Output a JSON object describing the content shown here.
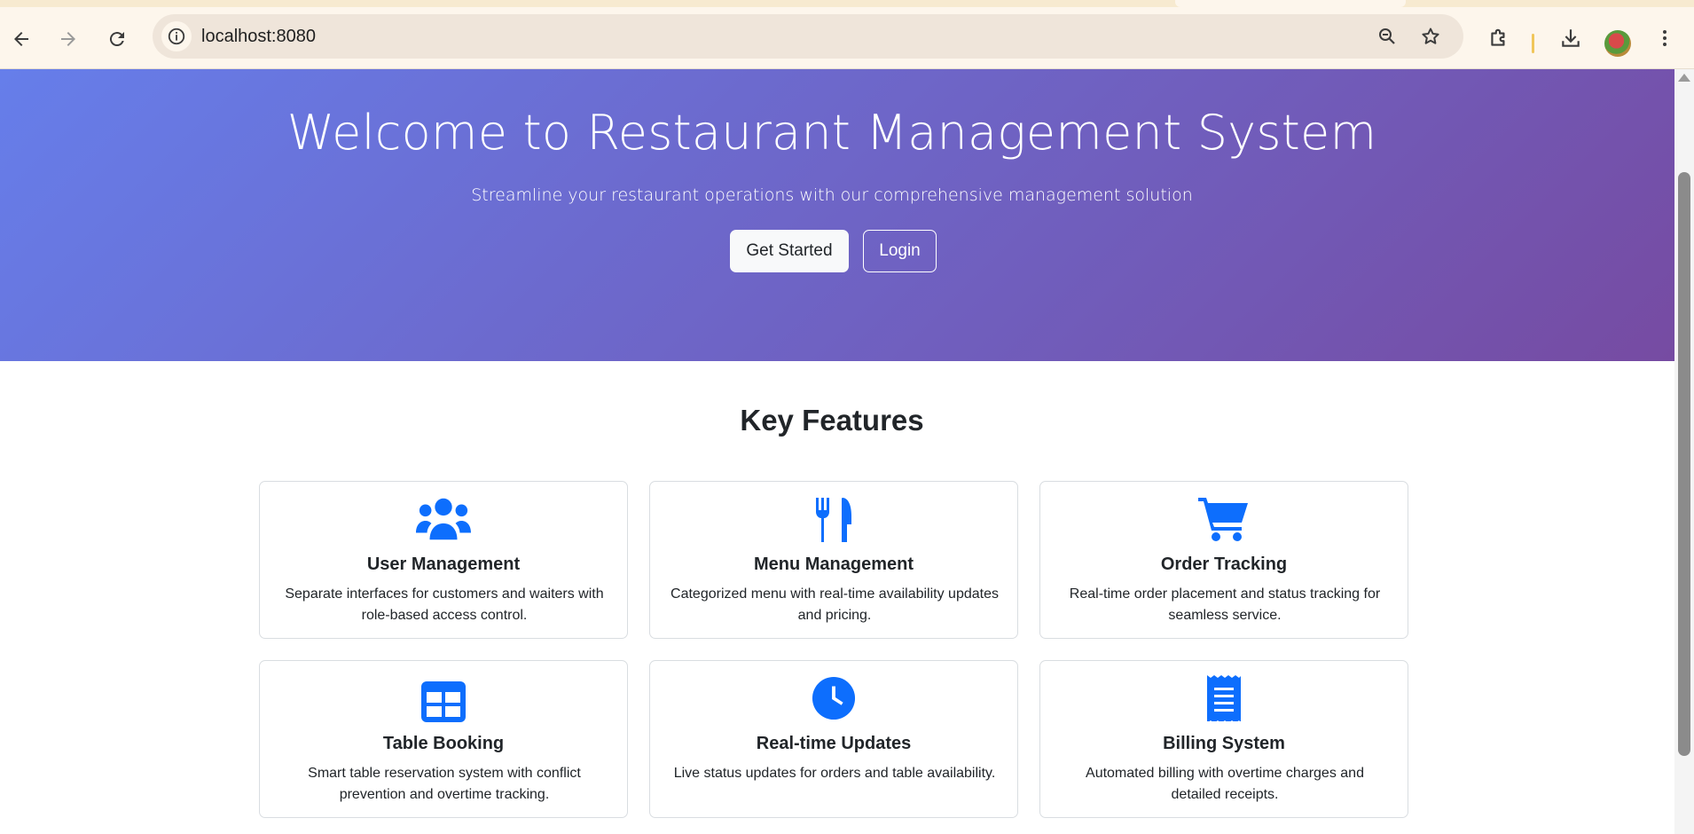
{
  "browser": {
    "url": "localhost:8080",
    "icons": [
      "back-icon",
      "forward-icon",
      "reload-icon",
      "site-info-icon",
      "zoom-icon",
      "bookmark-star-icon",
      "extensions-icon",
      "downloads-icon",
      "profile-avatar",
      "menu-icon"
    ]
  },
  "hero": {
    "title": "Welcome to Restaurant Management System",
    "subtitle": "Streamline your restaurant operations with our comprehensive management solution",
    "primary_button": "Get Started",
    "secondary_button": "Login",
    "gradient_colors": [
      "#667eea",
      "#764ba2"
    ]
  },
  "features": {
    "heading": "Key Features",
    "accent_color": "#0d6efd",
    "items": [
      {
        "icon": "users-icon",
        "title": "User Management",
        "description": "Separate interfaces for customers and waiters with role-based access control."
      },
      {
        "icon": "utensils-icon",
        "title": "Menu Management",
        "description": "Categorized menu with real-time availability updates and pricing."
      },
      {
        "icon": "cart-icon",
        "title": "Order Tracking",
        "description": "Real-time order placement and status tracking for seamless service."
      },
      {
        "icon": "table-icon",
        "title": "Table Booking",
        "description": "Smart table reservation system with conflict prevention and overtime tracking."
      },
      {
        "icon": "clock-icon",
        "title": "Real-time Updates",
        "description": "Live status updates for orders and table availability."
      },
      {
        "icon": "receipt-icon",
        "title": "Billing System",
        "description": "Automated billing with overtime charges and detailed receipts."
      }
    ]
  }
}
